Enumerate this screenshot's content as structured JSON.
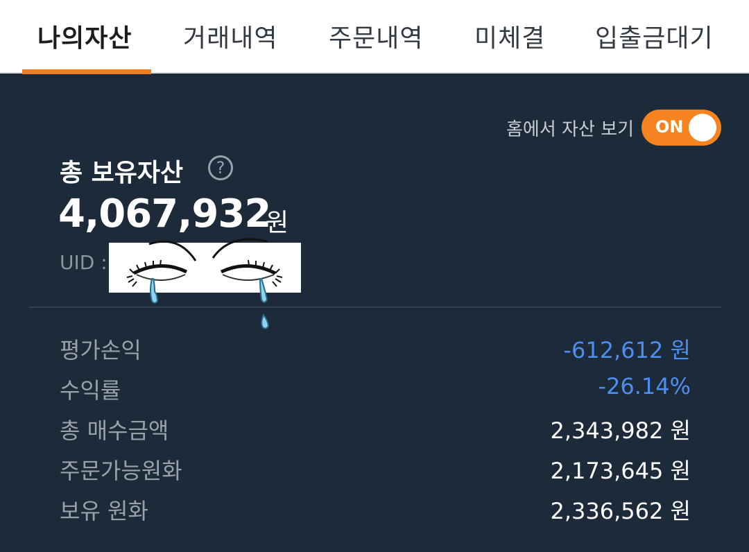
{
  "tabs": [
    {
      "label": "나의자산",
      "active": true
    },
    {
      "label": "거래내역",
      "active": false
    },
    {
      "label": "주문내역",
      "active": false
    },
    {
      "label": "미체결",
      "active": false
    },
    {
      "label": "입출금대기",
      "active": false
    }
  ],
  "home_toggle": {
    "label": "홈에서 자산 보기",
    "state": "ON"
  },
  "total": {
    "label": "총 보유자산",
    "help_icon": "question-circle-icon",
    "amount": "4,067,932",
    "unit": "원",
    "uid_label": "UID :"
  },
  "rows": [
    {
      "label": "평가손익",
      "value": "-612,612 원",
      "negative": true
    },
    {
      "label": "수익률",
      "value": "-26.14%",
      "negative": true
    },
    {
      "label": "총 매수금액",
      "value": "2,343,982 원",
      "negative": false
    },
    {
      "label": "주문가능원화",
      "value": "2,173,645 원",
      "negative": false
    },
    {
      "label": "보유 원화",
      "value": "2,336,562 원",
      "negative": false
    }
  ],
  "colors": {
    "accent": "#f5831f",
    "background": "#1c2a3a",
    "negative": "#4e8ef0"
  }
}
